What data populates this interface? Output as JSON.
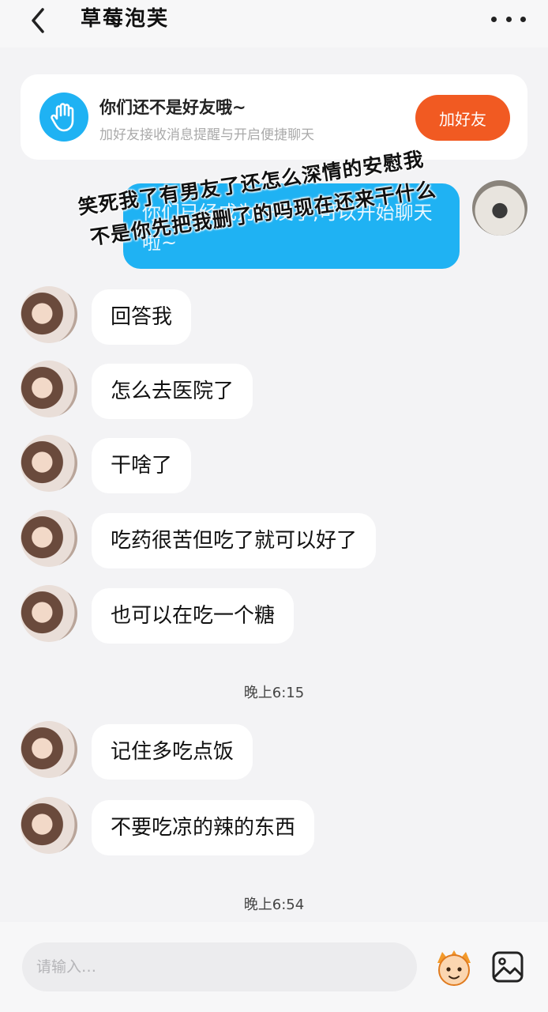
{
  "header": {
    "title": "草莓泡芙"
  },
  "notice": {
    "title": "你们还不是好友哦~",
    "subtitle": "加好友接收消息提醒与开启便捷聊天",
    "button": "加好友"
  },
  "outgoing": {
    "text": "你们已经成为好友了,可以开始聊天啦~"
  },
  "overlay": {
    "line1": "笑死我了有男友了还怎么深情的安慰我",
    "line2": "不是你先把我删了的吗现在还来干什么"
  },
  "messages": [
    {
      "text": "回答我"
    },
    {
      "text": "怎么去医院了"
    },
    {
      "text": "干啥了"
    },
    {
      "text": "吃药很苦但吃了就可以好了"
    },
    {
      "text": "也可以在吃一个糖"
    },
    {
      "text": "记住多吃点饭"
    },
    {
      "text": "不要吃凉的辣的东西"
    }
  ],
  "timestamps": [
    "晚上6:15",
    "晚上6:54"
  ],
  "input": {
    "placeholder": "请输入…"
  },
  "colors": {
    "accent": "#1fb2f3",
    "add_button": "#f15a22",
    "background": "#f3f3f5"
  },
  "icons": [
    "back-arrow-icon",
    "more-icon",
    "hand-icon",
    "emoji-icon",
    "image-icon"
  ]
}
